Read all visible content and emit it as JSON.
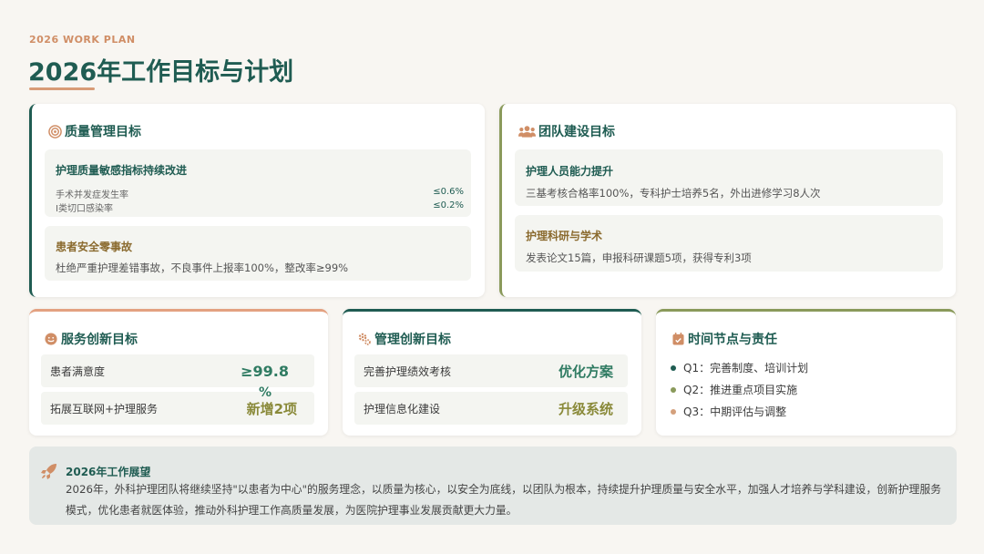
{
  "header": {
    "subtitle": "2026 WORK PLAN",
    "title": "2026年工作目标与计划"
  },
  "quality": {
    "title": "质量管理目标",
    "icon": "target-icon",
    "block1": {
      "title": "护理质量敏感指标持续改进",
      "rows": [
        {
          "label": "手术并发症发生率",
          "value": "≤0.6%"
        },
        {
          "label": "I类切口感染率",
          "value": "≤0.2%"
        }
      ]
    },
    "block2": {
      "title": "患者安全零事故",
      "text": "杜绝严重护理差错事故，不良事件上报率100%，整改率≥99%"
    }
  },
  "team": {
    "title": "团队建设目标",
    "icon": "team-icon",
    "block1": {
      "title": "护理人员能力提升",
      "text": "三基考核合格率100%，专科护士培养5名，外出进修学习8人次"
    },
    "block2": {
      "title": "护理科研与学术",
      "text": "发表论文15篇，申报科研课题5项，获得专利3项"
    }
  },
  "service": {
    "title": "服务创新目标",
    "icon": "smile-icon",
    "rows": [
      {
        "label": "患者满意度",
        "value": "≥99.8",
        "value2": "%"
      },
      {
        "label": "拓展互联网+护理服务",
        "value": "新增2项"
      }
    ]
  },
  "management": {
    "title": "管理创新目标",
    "icon": "gears-icon",
    "rows": [
      {
        "label": "完善护理绩效考核",
        "value": "优化方案"
      },
      {
        "label": "护理信息化建设",
        "value": "升级系统"
      }
    ]
  },
  "timeline": {
    "title": "时间节点与责任",
    "icon": "calendar-icon",
    "items": [
      {
        "text": "Q1：完善制度、培训计划",
        "color": "#1f5c52"
      },
      {
        "text": "Q2：推进重点项目实施",
        "color": "#8a9a5b"
      },
      {
        "text": "Q3：中期评估与调整",
        "color": "#d4a07c"
      }
    ]
  },
  "outlook": {
    "title": "2026年工作展望",
    "icon": "rocket-icon",
    "text": "2026年，外科护理团队将继续坚持\"以患者为中心\"的服务理念，以质量为核心，以安全为底线，以团队为根本，持续提升护理质量与安全水平，加强人才培养与学科建设，创新护理服务模式，优化患者就医体验，推动外科护理工作高质量发展，为医院护理事业发展贡献更大力量。"
  },
  "colors": {
    "primary": "#1f5c52",
    "olive": "#8a9a5b",
    "accent": "#d89b76",
    "valueGreen": "#2f7b62",
    "valueOlive": "#8a8a3a"
  }
}
